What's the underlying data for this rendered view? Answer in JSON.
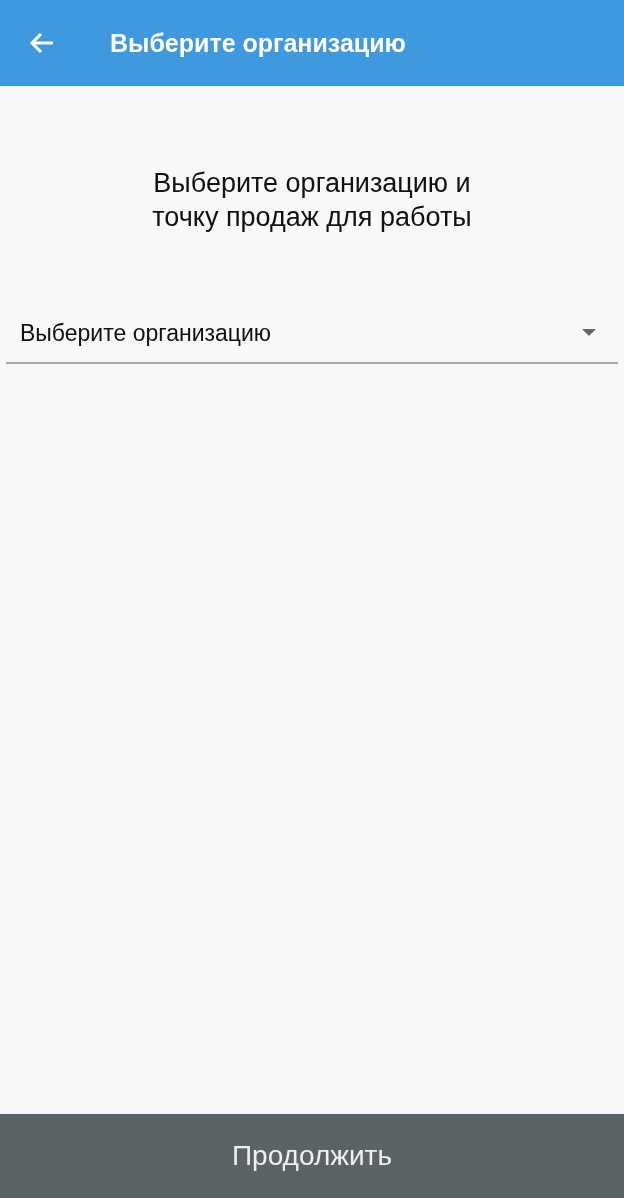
{
  "app_bar": {
    "title": "Выберите организацию"
  },
  "heading": "Выберите организацию и\nточку продаж для работы",
  "organization_dropdown": {
    "placeholder": "Выберите организацию"
  },
  "continue_button": {
    "label": "Продолжить"
  }
}
